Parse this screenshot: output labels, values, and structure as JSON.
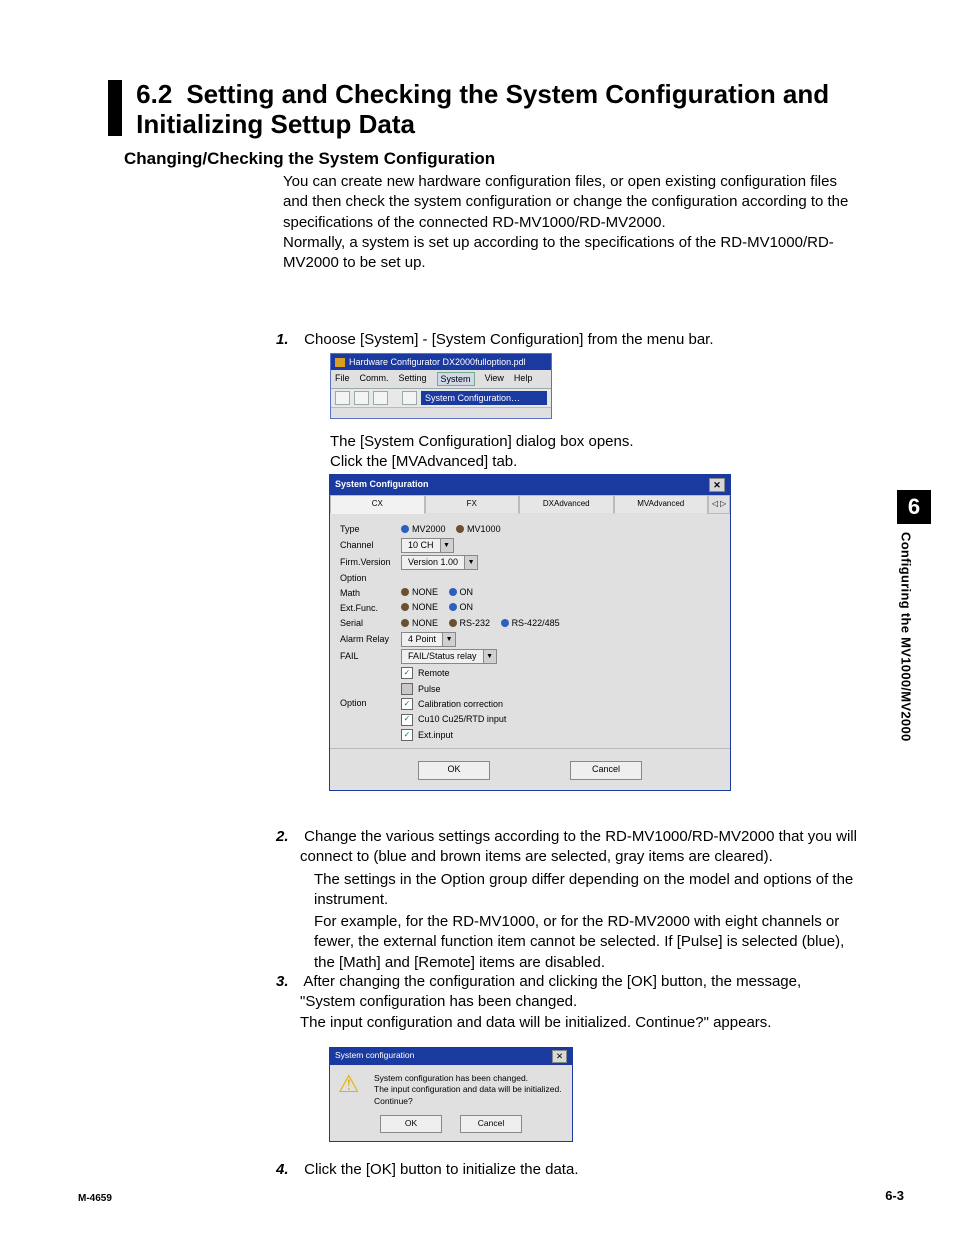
{
  "sidebar": {
    "chapter_number": "6",
    "chapter_title": "Configuring the MV1000/MV2000"
  },
  "heading": {
    "number": "6.2",
    "title": "Setting and Checking the System Configuration and Initializing Settup Data"
  },
  "subheading": "Changing/Checking the System Configuration",
  "intro": "You can create new hardware configuration files, or open existing configuration files and then check the system configuration or change the configuration according to the specifications of the connected RD-MV1000/RD-MV2000.\nNormally, a system is set up according to the specifications of the RD-MV1000/RD-MV2000 to be set up.",
  "step1": {
    "num": "1.",
    "text": "Choose [System] - [System Configuration] from the menu bar."
  },
  "sc1": {
    "title": "Hardware Configurator DX2000fulloption.pdl",
    "menu": {
      "file": "File",
      "comm": "Comm.",
      "setting": "Setting",
      "system": "System",
      "view": "View",
      "help": "Help"
    },
    "dropdown": "System Configuration…"
  },
  "after_sc1": {
    "a": "The [System Configuration] dialog box opens.",
    "b": "Click the [MVAdvanced] tab."
  },
  "sc2": {
    "title": "System Configuration",
    "tabs": {
      "cx": "CX",
      "fx": "FX",
      "dx": "DXAdvanced",
      "mv": "MVAdvanced"
    },
    "labels": {
      "type": "Type",
      "channel": "Channel",
      "firm": "Firm.Version",
      "option": "Option",
      "math": "Math",
      "ext": "Ext.Func.",
      "serial": "Serial",
      "alarm": "Alarm Relay",
      "fail": "FAIL",
      "option2": "Option"
    },
    "type_opts": {
      "a": "MV2000",
      "b": "MV1000"
    },
    "channel_val": "10 CH",
    "firm_val": "Version 1.00",
    "none": "NONE",
    "on": "ON",
    "serial_opts": {
      "a": "NONE",
      "b": "RS-232",
      "c": "RS-422/485"
    },
    "alarm_val": "4 Point",
    "fail_val": "FAIL/Status relay",
    "check": {
      "remote": "Remote",
      "pulse": "Pulse",
      "calib": "Calibration correction",
      "cu": "Cu10 Cu25/RTD input",
      "ext": "Ext.input"
    },
    "ok": "OK",
    "cancel": "Cancel"
  },
  "step2": {
    "num": "2.",
    "a": "Change the various settings according to the RD-MV1000/RD-MV2000 that you will connect to (blue and brown items are selected, gray items are cleared).",
    "b": "The settings in the Option group differ depending on the model and options of the instrument.",
    "c": "For example, for the RD-MV1000, or for the RD-MV2000 with eight channels or fewer, the external function item cannot be selected. If [Pulse] is selected (blue), the [Math] and [Remote] items are disabled."
  },
  "step3": {
    "num": "3.",
    "a": "After changing the configuration and clicking the [OK] button, the message, \"System configuration has been changed.",
    "b": "The input configuration and data will be initialized. Continue?\" appears."
  },
  "sc3": {
    "title": "System configuration",
    "msg": "System configuration has been changed.\nThe input configuration and data will be initialized.\nContinue?",
    "ok": "OK",
    "cancel": "Cancel"
  },
  "step4": {
    "num": "4.",
    "text": "Click the [OK] button to initialize the data."
  },
  "footer": {
    "left": "M-4659",
    "right": "6-3"
  }
}
